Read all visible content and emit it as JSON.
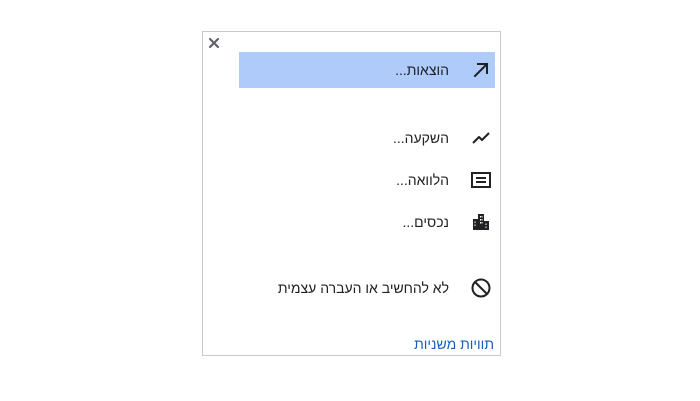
{
  "popup": {
    "close_icon": "close-icon",
    "items": [
      {
        "label": "הוצאות...",
        "icon": "arrow-up-right-icon",
        "selected": true
      },
      {
        "label": "השקעה...",
        "icon": "trending-line-icon",
        "selected": false
      },
      {
        "label": "הלוואה...",
        "icon": "card-list-icon",
        "selected": false
      },
      {
        "label": "נכסים...",
        "icon": "buildings-icon",
        "selected": false
      },
      {
        "label": "לא להחשיב או העברה עצמית",
        "icon": "block-icon",
        "selected": false
      }
    ],
    "secondary_link": "תוויות משניות"
  },
  "colors": {
    "selected_bg": "#aecbfa",
    "link": "#1a5fb4",
    "border": "#c9c9c9",
    "close": "#5f6368"
  }
}
